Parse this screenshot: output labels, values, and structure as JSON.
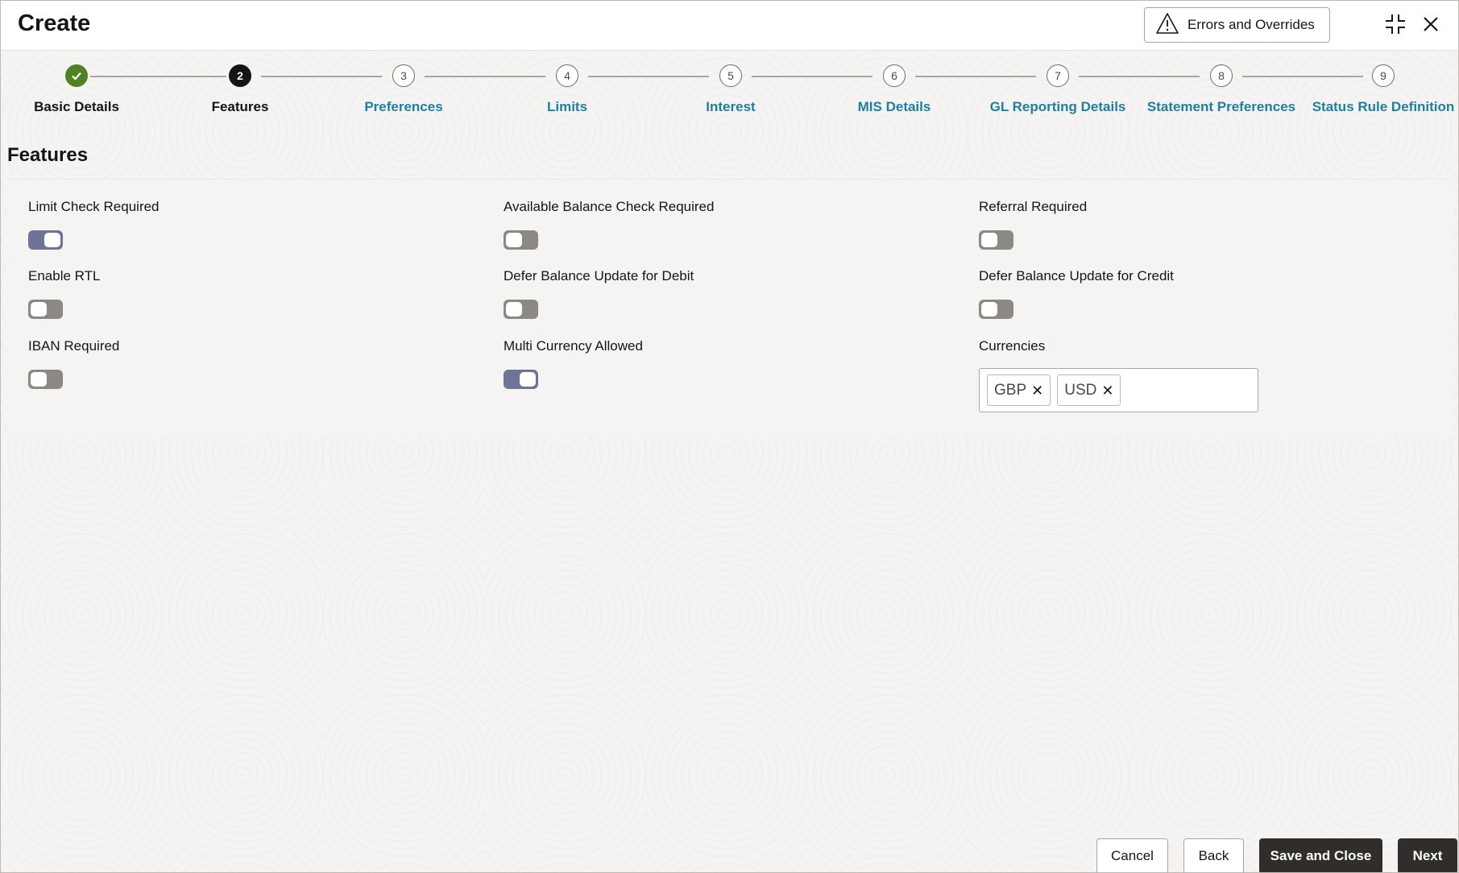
{
  "header": {
    "title": "Create",
    "errors_button_label": "Errors and Overrides"
  },
  "stepper": {
    "steps": [
      {
        "number": "",
        "label": "Basic Details",
        "state": "done"
      },
      {
        "number": "2",
        "label": "Features",
        "state": "current"
      },
      {
        "number": "3",
        "label": "Preferences",
        "state": "pending"
      },
      {
        "number": "4",
        "label": "Limits",
        "state": "pending"
      },
      {
        "number": "5",
        "label": "Interest",
        "state": "pending"
      },
      {
        "number": "6",
        "label": "MIS Details",
        "state": "pending"
      },
      {
        "number": "7",
        "label": "GL Reporting Details",
        "state": "pending"
      },
      {
        "number": "8",
        "label": "Statement Preferences",
        "state": "pending"
      },
      {
        "number": "9",
        "label": "Status Rule Definition",
        "state": "pending"
      }
    ]
  },
  "section": {
    "title": "Features"
  },
  "fields": {
    "limit_check_required": {
      "label": "Limit Check Required",
      "on": true
    },
    "available_balance_check_required": {
      "label": "Available Balance Check Required",
      "on": false
    },
    "referral_required": {
      "label": "Referral Required",
      "on": false
    },
    "enable_rtl": {
      "label": "Enable RTL",
      "on": false
    },
    "defer_balance_update_debit": {
      "label": "Defer Balance Update for Debit",
      "on": false
    },
    "defer_balance_update_credit": {
      "label": "Defer Balance Update for Credit",
      "on": false
    },
    "iban_required": {
      "label": "IBAN Required",
      "on": false
    },
    "multi_currency_allowed": {
      "label": "Multi Currency Allowed",
      "on": true
    },
    "currencies": {
      "label": "Currencies",
      "values": [
        "GBP",
        "USD"
      ]
    }
  },
  "footer": {
    "cancel_label": "Cancel",
    "back_label": "Back",
    "save_close_label": "Save and Close",
    "next_label": "Next"
  },
  "colors": {
    "step_done": "#508223",
    "step_current": "#161513",
    "step_link": "#227e9e",
    "toggle_on": "#6c7597",
    "toggle_off": "#8c8985",
    "button_dark": "#302d2a"
  }
}
